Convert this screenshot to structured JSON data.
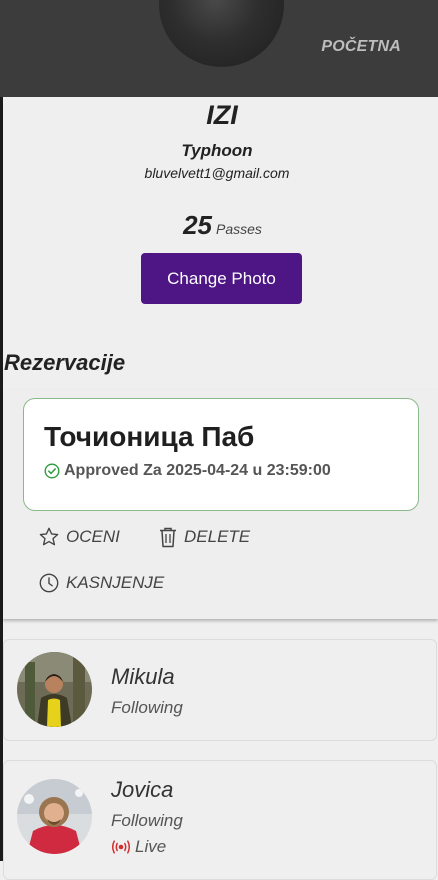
{
  "header": {
    "nav_link": "POČETNA"
  },
  "profile": {
    "name": "IZI",
    "subtitle": "Typhoon",
    "email": "bluvelvett1@gmail.com",
    "passes_count": "25",
    "passes_label": "Passes",
    "change_photo_label": "Change Photo"
  },
  "reservations": {
    "title": "Rezervacije",
    "items": [
      {
        "venue": "Точионица Паб",
        "status": "Approved Za 2025-04-24 u 23:59:00",
        "actions": {
          "rate": "OCENI",
          "delete": "DELETE",
          "late": "KASNJENJE"
        }
      }
    ]
  },
  "following": [
    {
      "name": "Mikula",
      "status": "Following"
    },
    {
      "name": "Jovica",
      "status": "Following",
      "live": "Live"
    }
  ],
  "colors": {
    "header_bg": "#3c3c3c",
    "primary_button": "#4d1684",
    "approved_green": "#2e9a3e",
    "live_red": "#d32f2f"
  }
}
